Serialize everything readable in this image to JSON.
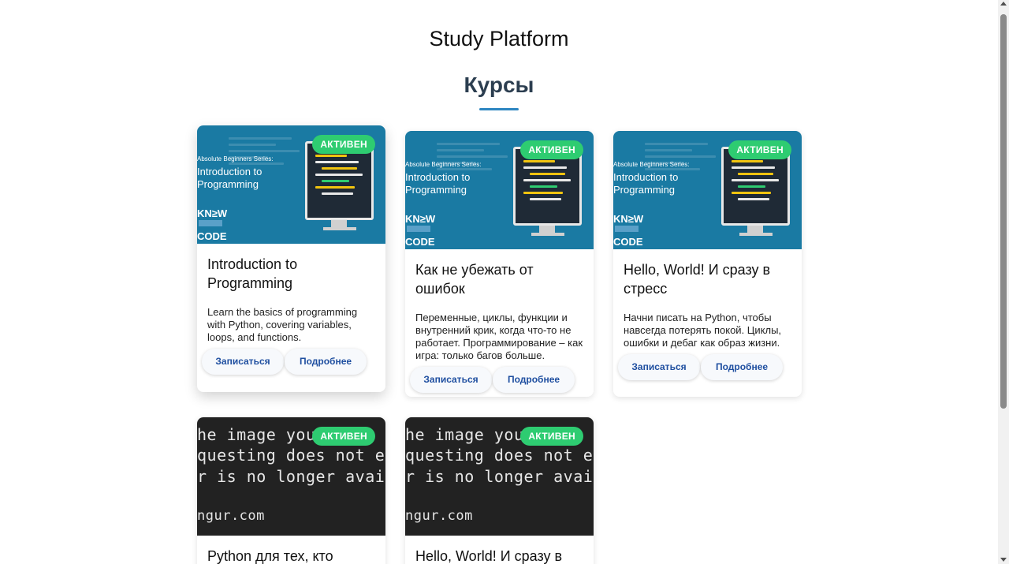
{
  "site": {
    "title": "Study Platform"
  },
  "section": {
    "title": "Курсы"
  },
  "colors": {
    "accent": "#2e86c1",
    "badge": "#2ecc71",
    "heading": "#2c3e50",
    "button_text": "#1f4fa0"
  },
  "buttons": {
    "enroll": "Записаться",
    "details": "Подробнее"
  },
  "thumb_art": {
    "series": "Absolute Beginners Series:",
    "intro_line1": "Introduction to",
    "intro_line2": "Programming",
    "brand_top": "KN≥W",
    "brand_bottom": "CODE",
    "imgur_line1": "he image you a",
    "imgur_line2": "questing does not exi",
    "imgur_line3": "r is no longer available",
    "imgur_line4": "ngur.com"
  },
  "courses": [
    {
      "status": "АКТИВЕН",
      "thumb": "programming",
      "title": "Introduction to Programming",
      "description": "Learn the basics of programming with Python, covering variables, loops, and functions."
    },
    {
      "status": "АКТИВЕН",
      "thumb": "programming",
      "title": "Как не убежать от ошибок",
      "description": "Переменные, циклы, функции и внутренний крик, когда что-то не работает. Программирование – как игра: только багов больше."
    },
    {
      "status": "АКТИВЕН",
      "thumb": "programming",
      "title": "Hello, World! И сразу в стресс",
      "description": "Начни писать на Python, чтобы навсегда потерять покой. Циклы, ошибки и дебаг как образ жизни."
    },
    {
      "status": "АКТИВЕН",
      "thumb": "imgur-missing",
      "title": "Python для тех, кто"
    },
    {
      "status": "АКТИВЕН",
      "thumb": "imgur-missing",
      "title": "Hello, World! И сразу в"
    }
  ]
}
